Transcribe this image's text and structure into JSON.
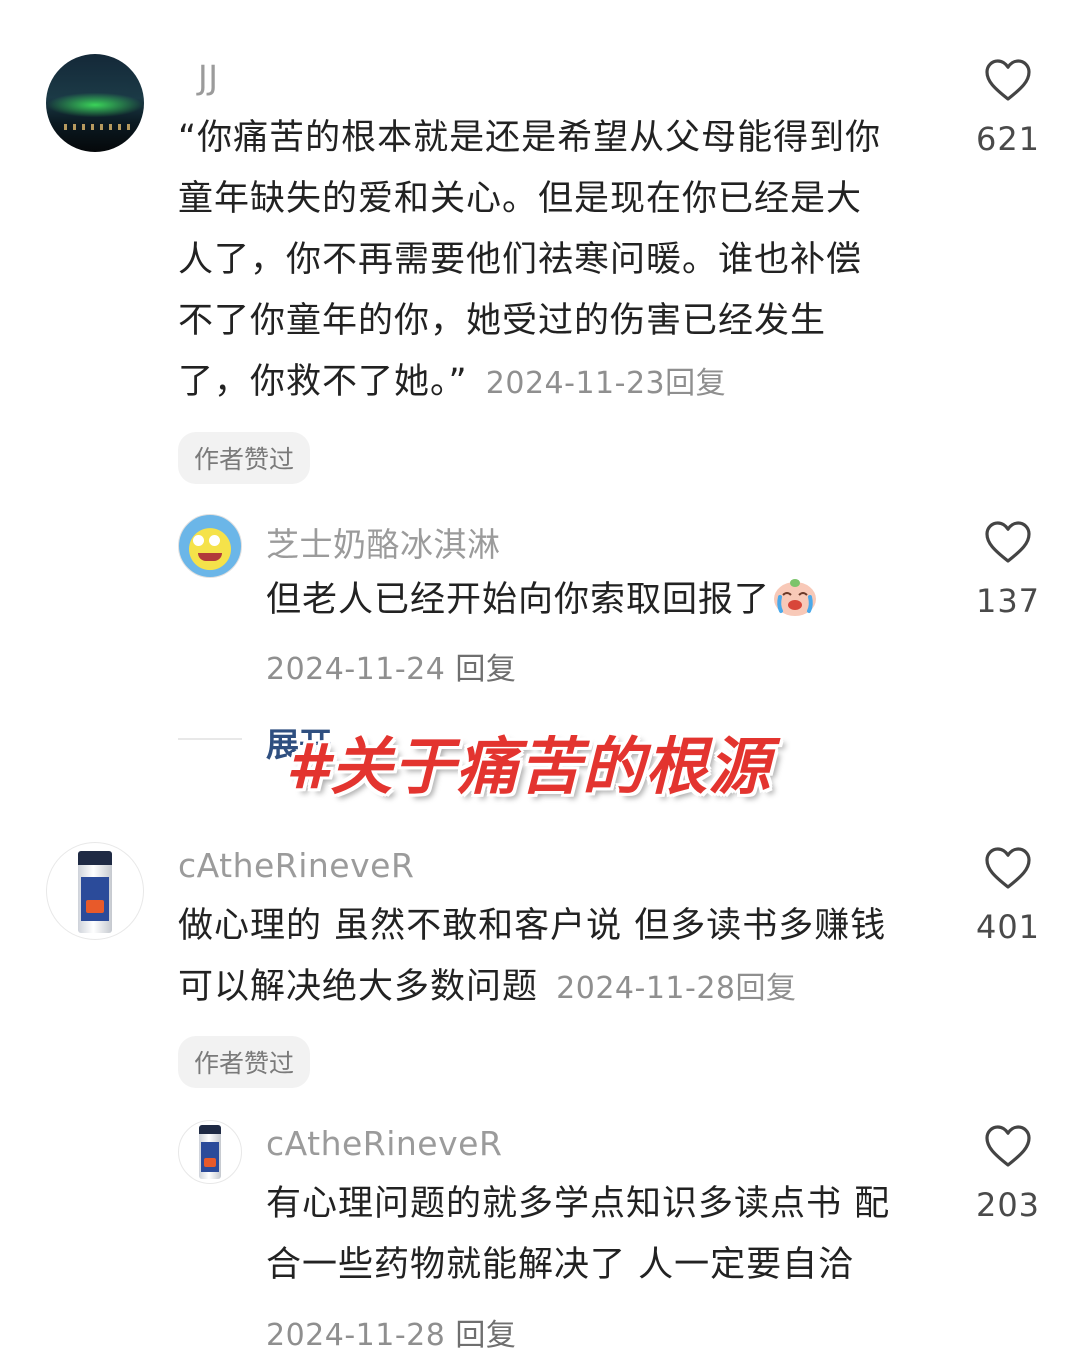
{
  "overlay": {
    "title": "#关于痛苦的根源"
  },
  "comments": [
    {
      "username": "JJ",
      "lines": [
        "“你痛苦的根本就是还是希望从父母能得到你",
        "童年缺失的爱和关心。但是现在你已经是大",
        "人了，你不再需要他们祛寒问暖。谁也补偿",
        "不了你童年的你，她受过的伤害已经发生",
        "了，你救不了她。”"
      ],
      "date": "2024-11-23",
      "reply_label": "回复",
      "badge": "作者赞过",
      "likes": "621",
      "avatar_icon": "aurora-avatar",
      "replies": [
        {
          "username": "芝士奶酪冰淇淋",
          "lines": [
            "但老人已经开始向你索取回报了"
          ],
          "emoji": "crying-laughing-emoji",
          "date": "2024-11-24",
          "reply_label": "回复",
          "likes": "137",
          "avatar_icon": "spongebob-avatar"
        }
      ],
      "expand_label": "展开"
    },
    {
      "username": "cAtheRineveR",
      "lines": [
        "做心理的 虽然不敢和客户说 但多读书多赚钱",
        "可以解决绝大多数问题"
      ],
      "date": "2024-11-28",
      "reply_label": "回复",
      "badge": "作者赞过",
      "likes": "401",
      "avatar_icon": "bottle-avatar",
      "replies": [
        {
          "username": "cAtheRineveR",
          "lines": [
            "有心理问题的就多学点知识多读点书 配",
            "合一些药物就能解决了 人一定要自洽"
          ],
          "date": "2024-11-28",
          "reply_label": "回复",
          "likes": "203",
          "avatar_icon": "bottle-avatar"
        }
      ]
    }
  ]
}
